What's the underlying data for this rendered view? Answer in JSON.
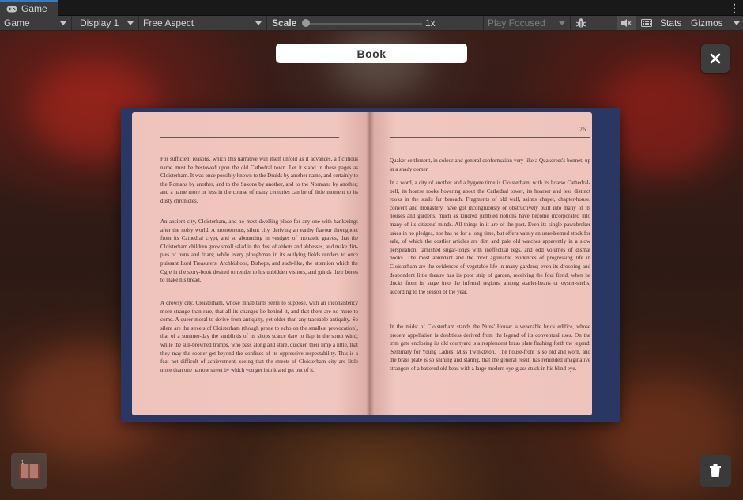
{
  "tab": {
    "label": "Game",
    "icon": "gamepad-icon"
  },
  "toolbar": {
    "view_mode": "Game",
    "display": "Display 1",
    "aspect": "Free Aspect",
    "scale_label": "Scale",
    "scale_value": "1x",
    "scale_fraction": 0.0,
    "play_mode": "Play Focused",
    "stats_label": "Stats",
    "gizmos_label": "Gizmos",
    "icons": [
      "bug-icon",
      "audio-mute-icon",
      "keyboard-icon"
    ]
  },
  "overlay": {
    "title": "Book",
    "close_icon": "close-icon",
    "trash_icon": "trash-icon",
    "book_icon": "open-book-icon"
  },
  "book": {
    "right_page_number": "26",
    "left_paragraphs": [
      "For sufficient reasons, which this narrative will itself unfold as it advances, a fictitious name must be bestowed upon the old Cathedral town. Let it stand in these pages as Cloisterham. It was once possibly known to the Druids by another name, and certainly to the Romans by another, and to the Saxons by another, and to the Normans by another; and a name more or less in the course of many centuries can be of little moment to its dusty chronicles.",
      "An ancient city, Cloisterham, and no meet dwelling-place for any one with hankerings after the noisy world. A monotonous, silent city, deriving an earthy flavour throughout from its Cathedral crypt, and so abounding in vestiges of monastic graves, that the Cloisterham children grow small salad in the dust of abbots and abbesses, and make dirt-pies of nuns and friars; while every ploughman in its outlying fields renders to once puissant Lord Treasurers, Archbishops, Bishops, and such-like, the attention which the Ogre in the story-book desired to render to his unbidden visitors, and grinds their bones to make his bread.",
      "A drowsy city, Cloisterham, whose inhabitants seem to suppose, with an inconsistency more strange than rare, that all its changes lie behind it, and that there are no more to come. A queer moral to derive from antiquity, yet older than any traceable antiquity. So silent are the streets of Cloisterham (though prone to echo on the smallest provocation), that of a summer-day the sunblinds of its shops scarce dare to flap in the south wind; while the sun-browned tramps, who pass along and stare, quicken their limp a little, that they may the sooner get beyond the confines of its oppressive respectability. This is a feat not difficult of achievement, seeing that the streets of Cloisterham city are little more than one narrow street by which you get into it and get out of it."
    ],
    "right_paragraphs": [
      "Quaker settlement, in colour and general conformation very like a Quakeress's bonnet, up in a shady corner.",
      "In a word, a city of another and a bygone time is Cloisterham, with its hoarse Cathedral-bell, its hoarse rooks hovering about the Cathedral tower, its hoarser and less distinct rooks in the stalls far beneath. Fragments of old wall, saint's chapel, chapter-house, convent and monastery, have got incongruously or obstructively built into many of its houses and gardens, much as kindred jumbled notions have become incorporated into many of its citizens' minds. All things in it are of the past. Even its single pawnbroker takes in no pledges, nor has he for a long time, but offers vainly an unredeemed stock for sale, of which the costlier articles are dim and pale old watches apparently in a slow perspiration, tarnished sugar-tongs with ineffectual legs, and odd volumes of dismal books. The most abundant and the most agreeable evidences of progressing life in Cloisterham are the evidences of vegetable life in many gardens; even its drooping and despondent little theatre has its poor strip of garden, receiving the foul fiend, when he ducks from its stage into the infernal regions, among scarlet-beans or oyster-shells, according to the season of the year.",
      "In the midst of Cloisterham stands the Nuns' House: a venerable brick edifice, whose present appellation is doubtless derived from the legend of its conventual uses. On the trim gate enclosing its old courtyard is a resplendent brass plate flashing forth the legend: 'Seminary for Young Ladies. Miss Twinkleton.' The house-front is so old and worn, and the brass plate is so shining and staring, that the general result has reminded imaginative strangers of a battered old beau with a large modern eye-glass stuck in his blind eye."
    ]
  }
}
